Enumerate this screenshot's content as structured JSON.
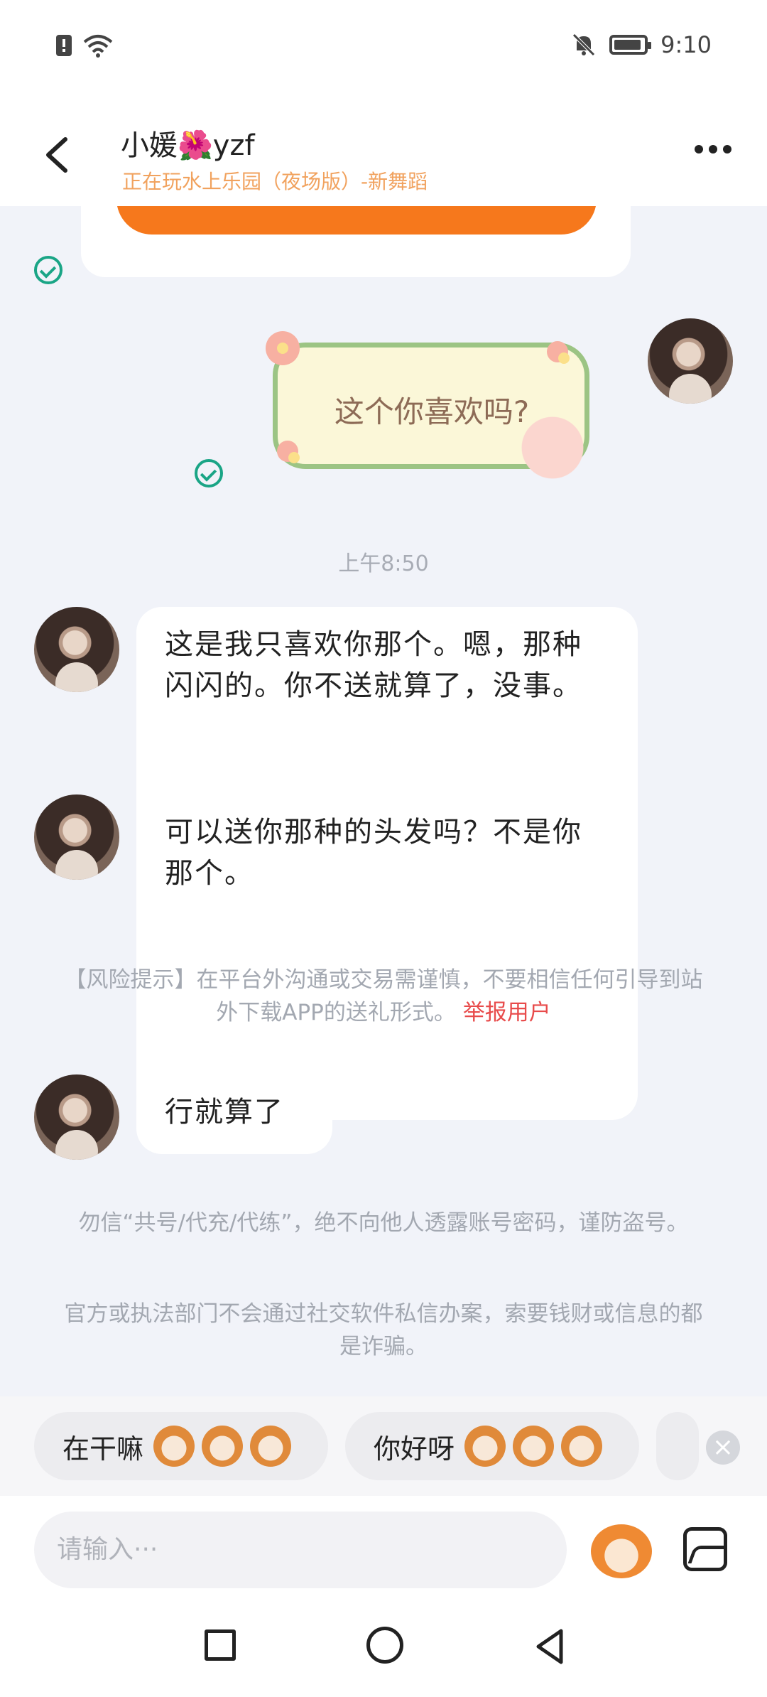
{
  "status_bar": {
    "time": "9:10"
  },
  "header": {
    "contact_name": "小媛🌺yzf",
    "status": "正在玩水上乐园（夜场版）-新舞蹈"
  },
  "chat": {
    "sticker_text": "这个你喜欢吗?",
    "time_divider": "上午8:50",
    "messages": [
      {
        "text": "这是我只喜欢你那个。嗯，那种闪闪的。你不送就算了，没事。"
      },
      {
        "text": "可以送你那种的头发吗？不是你那个。"
      },
      {
        "text": "行就算了"
      }
    ],
    "risk_notice": "【风险提示】在平台外沟通或交易需谨慎，不要相信任何引导到站外下载APP的送礼形式。",
    "report_link": "举报用户",
    "warning_1": "勿信“共号/代充/代练”，绝不向他人透露账号密码，谨防盗号。",
    "warning_2": "官方或执法部门不会通过社交软件私信办案，索要钱财或信息的都是诈骗。"
  },
  "quick_replies": [
    {
      "label": "在干嘛"
    },
    {
      "label": "你好呀"
    }
  ],
  "input": {
    "placeholder": "请输入···"
  }
}
